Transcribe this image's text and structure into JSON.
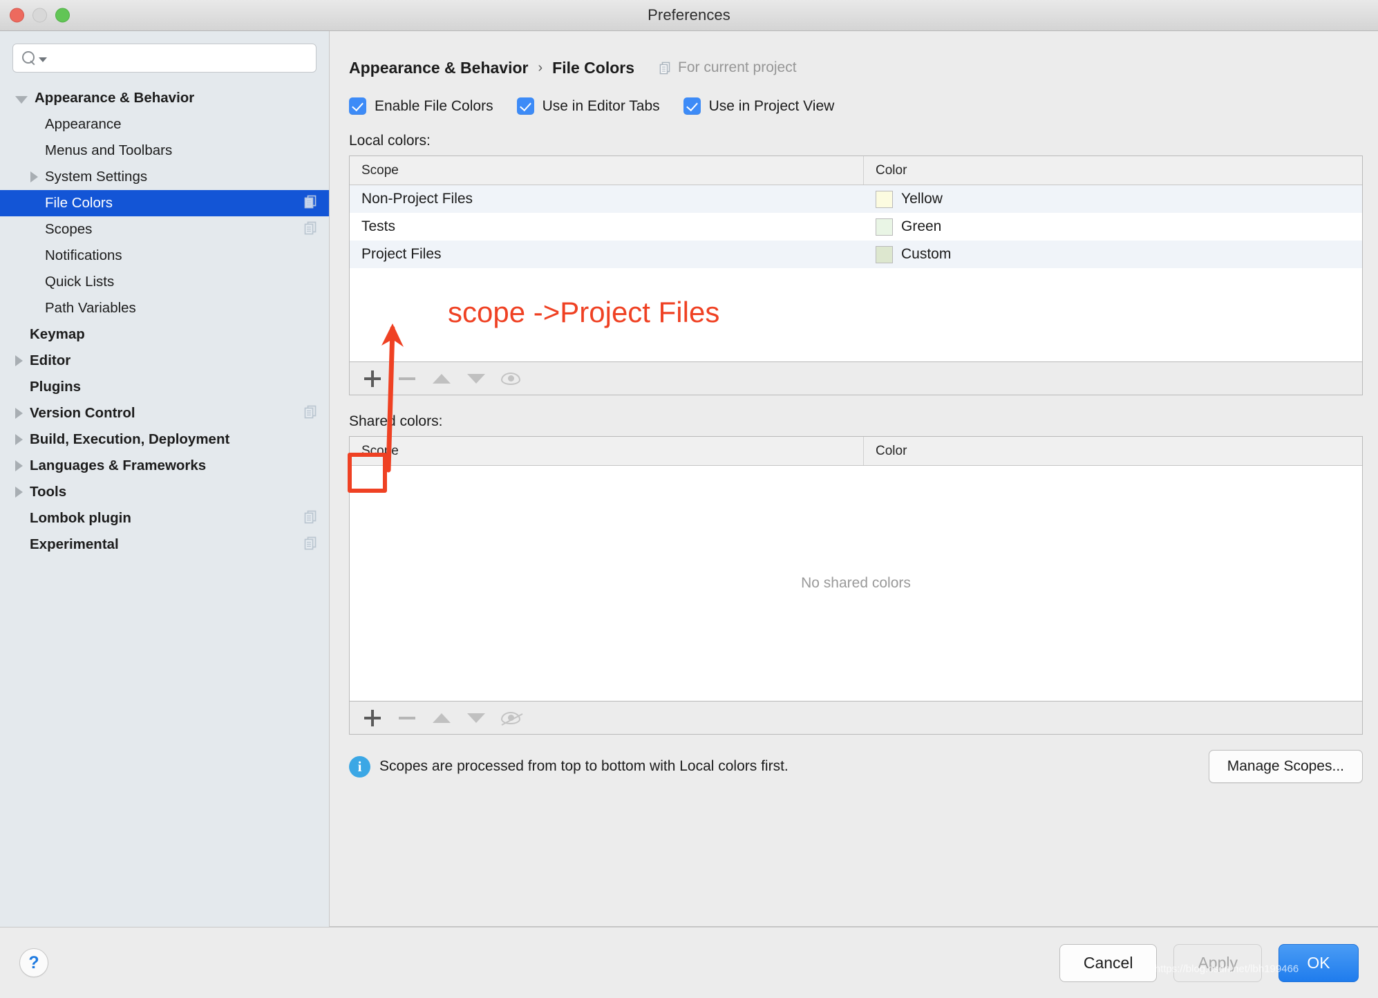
{
  "window": {
    "title": "Preferences"
  },
  "sidebar": {
    "search": {
      "value": "",
      "placeholder": ""
    },
    "items": [
      {
        "label": "Appearance & Behavior",
        "indent": 0,
        "arrow": "down",
        "bold": true,
        "selected": false,
        "copy": false
      },
      {
        "label": "Appearance",
        "indent": 1,
        "arrow": "none",
        "bold": false,
        "selected": false,
        "copy": false
      },
      {
        "label": "Menus and Toolbars",
        "indent": 1,
        "arrow": "none",
        "bold": false,
        "selected": false,
        "copy": false
      },
      {
        "label": "System Settings",
        "indent": 1,
        "arrow": "right",
        "bold": false,
        "selected": false,
        "copy": false
      },
      {
        "label": "File Colors",
        "indent": 1,
        "arrow": "none",
        "bold": false,
        "selected": true,
        "copy": true
      },
      {
        "label": "Scopes",
        "indent": 1,
        "arrow": "none",
        "bold": false,
        "selected": false,
        "copy": true
      },
      {
        "label": "Notifications",
        "indent": 1,
        "arrow": "none",
        "bold": false,
        "selected": false,
        "copy": false
      },
      {
        "label": "Quick Lists",
        "indent": 1,
        "arrow": "none",
        "bold": false,
        "selected": false,
        "copy": false
      },
      {
        "label": "Path Variables",
        "indent": 1,
        "arrow": "none",
        "bold": false,
        "selected": false,
        "copy": false
      },
      {
        "label": "Keymap",
        "indent": 0,
        "arrow": "none",
        "bold": true,
        "selected": false,
        "copy": false
      },
      {
        "label": "Editor",
        "indent": 0,
        "arrow": "right",
        "bold": true,
        "selected": false,
        "copy": false
      },
      {
        "label": "Plugins",
        "indent": 0,
        "arrow": "none",
        "bold": true,
        "selected": false,
        "copy": false
      },
      {
        "label": "Version Control",
        "indent": 0,
        "arrow": "right",
        "bold": true,
        "selected": false,
        "copy": true
      },
      {
        "label": "Build, Execution, Deployment",
        "indent": 0,
        "arrow": "right",
        "bold": true,
        "selected": false,
        "copy": false
      },
      {
        "label": "Languages & Frameworks",
        "indent": 0,
        "arrow": "right",
        "bold": true,
        "selected": false,
        "copy": false
      },
      {
        "label": "Tools",
        "indent": 0,
        "arrow": "right",
        "bold": true,
        "selected": false,
        "copy": false
      },
      {
        "label": "Lombok plugin",
        "indent": 0,
        "arrow": "none",
        "bold": true,
        "selected": false,
        "copy": true
      },
      {
        "label": "Experimental",
        "indent": 0,
        "arrow": "none",
        "bold": true,
        "selected": false,
        "copy": true
      }
    ]
  },
  "main": {
    "breadcrumb": {
      "parent": "Appearance & Behavior",
      "separator": "›",
      "current": "File Colors"
    },
    "for_current_project": "For current project",
    "checkboxes": [
      {
        "label": "Enable File Colors",
        "checked": true
      },
      {
        "label": "Use in Editor Tabs",
        "checked": true
      },
      {
        "label": "Use in Project View",
        "checked": true
      }
    ],
    "local_colors": {
      "label": "Local colors:",
      "columns": [
        "Scope",
        "Color"
      ],
      "rows": [
        {
          "scope": "Non-Project Files",
          "color_name": "Yellow",
          "swatch": "#fcfbe0"
        },
        {
          "scope": "Tests",
          "color_name": "Green",
          "swatch": "#e9f5e5"
        },
        {
          "scope": "Project Files",
          "color_name": "Custom",
          "swatch": "#dde7cf"
        }
      ],
      "toolbar": [
        "add-icon",
        "remove-icon",
        "move-up-icon",
        "move-down-icon",
        "eye-icon"
      ]
    },
    "shared_colors": {
      "label": "Shared colors:",
      "columns": [
        "Scope",
        "Color"
      ],
      "rows": [],
      "empty_message": "No shared colors",
      "toolbar": [
        "add-icon",
        "remove-icon",
        "move-up-icon",
        "move-down-icon",
        "eye-off-icon"
      ]
    },
    "info": {
      "text": "Scopes are processed from top to bottom with Local colors first.",
      "manage_button": "Manage Scopes..."
    }
  },
  "footer": {
    "help": "?",
    "cancel": "Cancel",
    "apply": "Apply",
    "ok": "OK"
  },
  "annotations": {
    "note_text": "scope ->Project Files",
    "note_color": "#ef4123",
    "watermark": "https://blog.csdn.net/lbh199466"
  }
}
